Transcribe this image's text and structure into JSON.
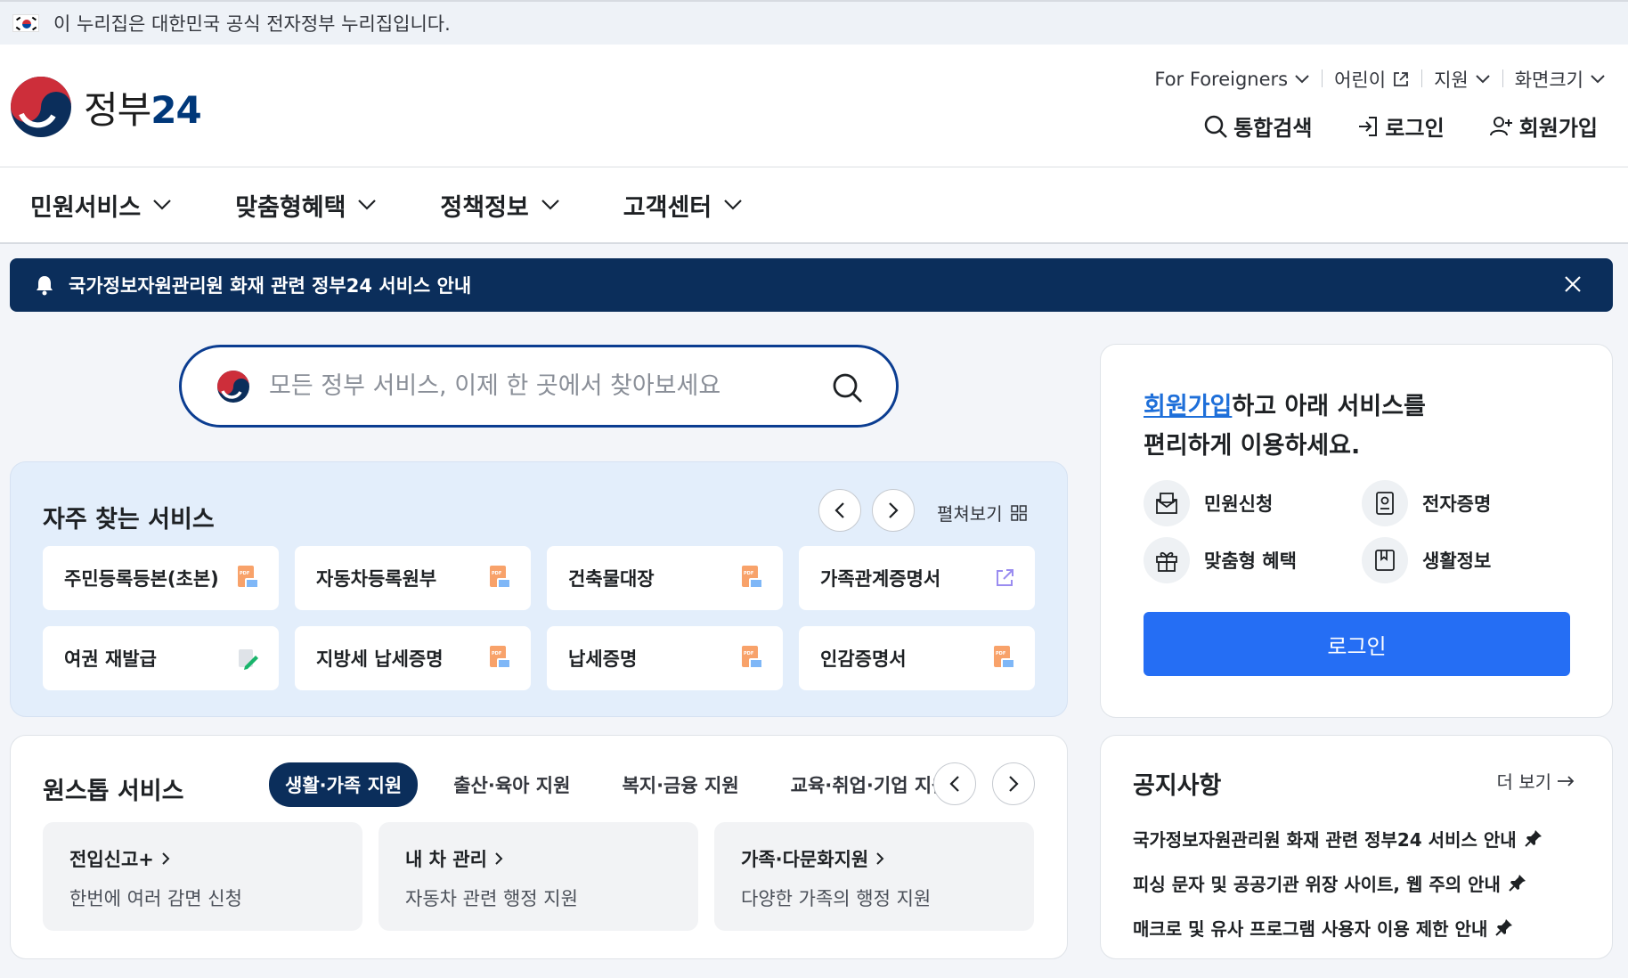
{
  "gov_banner": {
    "text": "이 누리집은 대한민국 공식 전자정부 누리집입니다."
  },
  "logo": {
    "text": "정부",
    "number": "24"
  },
  "util_nav": [
    {
      "label": "For Foreigners",
      "icon": "chevron-down-icon"
    },
    {
      "label": "어린이",
      "icon": "external-link-icon"
    },
    {
      "label": "지원",
      "icon": "chevron-down-icon"
    },
    {
      "label": "화면크기",
      "icon": "chevron-down-icon"
    }
  ],
  "main_actions": {
    "search": "통합검색",
    "login": "로그인",
    "signup": "회원가입"
  },
  "gnb": [
    "민원서비스",
    "맞춤형혜택",
    "정책정보",
    "고객센터"
  ],
  "alert": {
    "text": "국가정보자원관리원 화재 관련 정부24 서비스 안내"
  },
  "search": {
    "placeholder": "모든 정부 서비스, 이제 한 곳에서 찾아보세요"
  },
  "frequent": {
    "title": "자주 찾는 서비스",
    "spread_label": "펼쳐보기",
    "items": [
      {
        "label": "주민등록등본(초본)",
        "icon": "pdf-print-icon"
      },
      {
        "label": "자동차등록원부",
        "icon": "pdf-print-icon"
      },
      {
        "label": "건축물대장",
        "icon": "pdf-print-icon"
      },
      {
        "label": "가족관계증명서",
        "icon": "external-link-icon"
      },
      {
        "label": "여권 재발급",
        "icon": "pencil-icon"
      },
      {
        "label": "지방세 납세증명",
        "icon": "pdf-print-icon"
      },
      {
        "label": "납세증명",
        "icon": "pdf-print-icon"
      },
      {
        "label": "인감증명서",
        "icon": "pdf-print-icon"
      }
    ]
  },
  "onestop": {
    "title": "원스톱 서비스",
    "tabs": [
      "생활·가족 지원",
      "출산·육아 지원",
      "복지·금융 지원",
      "교육·취업·기업 지원"
    ],
    "active_tab": 0,
    "cards": [
      {
        "title": "전입신고+",
        "desc": "한번에 여러 감면 신청"
      },
      {
        "title": "내 차 관리",
        "desc": "자동차 관련 행정 지원"
      },
      {
        "title": "가족·다문화지원",
        "desc": "다양한 가족의 행정 지원"
      }
    ]
  },
  "login_panel": {
    "link": "회원가입",
    "head_rest": "하고 아래 서비스를",
    "head_line2": "편리하게 이용하세요.",
    "items": [
      {
        "label": "민원신청",
        "icon": "envelope-icon"
      },
      {
        "label": "전자증명",
        "icon": "id-card-icon"
      },
      {
        "label": "맞춤형 혜택",
        "icon": "gift-icon"
      },
      {
        "label": "생활정보",
        "icon": "bookmark-icon"
      }
    ],
    "button": "로그인"
  },
  "notice": {
    "title": "공지사항",
    "more": "더 보기",
    "items": [
      "국가정보자원관리원 화재 관련 정부24 서비스 안내",
      "피싱 문자 및 공공기관 위장 사이트, 웹 주의 안내",
      "매크로 및 유사 프로그램 사용자 이용 제한 안내"
    ]
  },
  "colors": {
    "navy": "#0b2e5b",
    "primary_blue": "#256ef4",
    "panel_blue": "#e3eefb",
    "link_blue": "#1e6fd9"
  }
}
